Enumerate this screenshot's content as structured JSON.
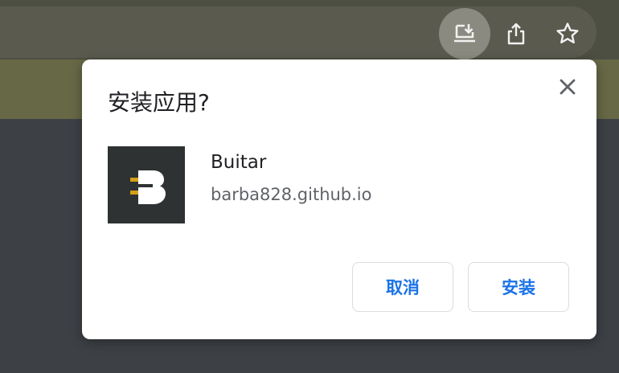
{
  "toolbar": {
    "icons": [
      {
        "name": "install-app-icon",
        "active": true
      },
      {
        "name": "share-icon",
        "active": false
      },
      {
        "name": "bookmark-star-icon",
        "active": false
      }
    ]
  },
  "dialog": {
    "title": "安装应用?",
    "close_icon": "close-icon",
    "app": {
      "name": "Buitar",
      "origin": "barba828.github.io",
      "icon_colors": {
        "background": "#2e3233",
        "letter": "#ffffff",
        "accent": "#d4a017"
      }
    },
    "buttons": {
      "cancel": "取消",
      "install": "安装"
    },
    "accent_color": "#1a73e8"
  }
}
